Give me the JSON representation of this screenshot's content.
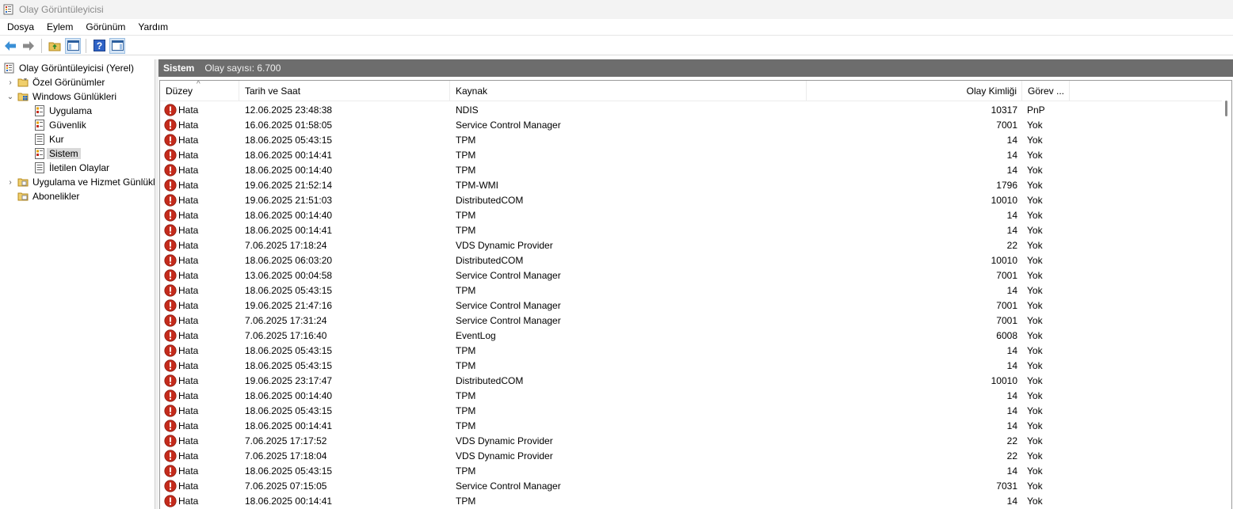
{
  "window": {
    "title": "Olay Görüntüleyicisi"
  },
  "menu": [
    "Dosya",
    "Eylem",
    "Görünüm",
    "Yardım"
  ],
  "toolbar": {
    "buttons": [
      "back-arrow-icon",
      "forward-arrow-icon",
      "folder-up-icon",
      "show-hide-tree-icon",
      "help-icon",
      "show-hide-action-pane-icon"
    ]
  },
  "tree": {
    "root": "Olay Görüntüleyicisi (Yerel)",
    "custom_views": "Özel Görünümler",
    "windows_logs": "Windows Günlükleri",
    "app": "Uygulama",
    "security": "Güvenlik",
    "setup": "Kur",
    "system": "Sistem",
    "forwarded": "İletilen Olaylar",
    "app_services": "Uygulama ve Hizmet Günlükleri",
    "subscriptions": "Abonelikler"
  },
  "pane": {
    "title": "Sistem",
    "count": "Olay sayısı: 6.700"
  },
  "columns": {
    "level": "Düzey",
    "date": "Tarih ve Saat",
    "source": "Kaynak",
    "id": "Olay Kimliği",
    "task": "Görev ..."
  },
  "rows": [
    {
      "level": "Hata",
      "date": "12.06.2025 23:48:38",
      "source": "NDIS",
      "id": "10317",
      "task": "PnP"
    },
    {
      "level": "Hata",
      "date": "16.06.2025 01:58:05",
      "source": "Service Control Manager",
      "id": "7001",
      "task": "Yok"
    },
    {
      "level": "Hata",
      "date": "18.06.2025 05:43:15",
      "source": "TPM",
      "id": "14",
      "task": "Yok"
    },
    {
      "level": "Hata",
      "date": "18.06.2025 00:14:41",
      "source": "TPM",
      "id": "14",
      "task": "Yok"
    },
    {
      "level": "Hata",
      "date": "18.06.2025 00:14:40",
      "source": "TPM",
      "id": "14",
      "task": "Yok"
    },
    {
      "level": "Hata",
      "date": "19.06.2025 21:52:14",
      "source": "TPM-WMI",
      "id": "1796",
      "task": "Yok"
    },
    {
      "level": "Hata",
      "date": "19.06.2025 21:51:03",
      "source": "DistributedCOM",
      "id": "10010",
      "task": "Yok"
    },
    {
      "level": "Hata",
      "date": "18.06.2025 00:14:40",
      "source": "TPM",
      "id": "14",
      "task": "Yok"
    },
    {
      "level": "Hata",
      "date": "18.06.2025 00:14:41",
      "source": "TPM",
      "id": "14",
      "task": "Yok"
    },
    {
      "level": "Hata",
      "date": "7.06.2025 17:18:24",
      "source": "VDS Dynamic Provider",
      "id": "22",
      "task": "Yok"
    },
    {
      "level": "Hata",
      "date": "18.06.2025 06:03:20",
      "source": "DistributedCOM",
      "id": "10010",
      "task": "Yok"
    },
    {
      "level": "Hata",
      "date": "13.06.2025 00:04:58",
      "source": "Service Control Manager",
      "id": "7001",
      "task": "Yok"
    },
    {
      "level": "Hata",
      "date": "18.06.2025 05:43:15",
      "source": "TPM",
      "id": "14",
      "task": "Yok"
    },
    {
      "level": "Hata",
      "date": "19.06.2025 21:47:16",
      "source": "Service Control Manager",
      "id": "7001",
      "task": "Yok"
    },
    {
      "level": "Hata",
      "date": "7.06.2025 17:31:24",
      "source": "Service Control Manager",
      "id": "7001",
      "task": "Yok"
    },
    {
      "level": "Hata",
      "date": "7.06.2025 17:16:40",
      "source": "EventLog",
      "id": "6008",
      "task": "Yok"
    },
    {
      "level": "Hata",
      "date": "18.06.2025 05:43:15",
      "source": "TPM",
      "id": "14",
      "task": "Yok"
    },
    {
      "level": "Hata",
      "date": "18.06.2025 05:43:15",
      "source": "TPM",
      "id": "14",
      "task": "Yok"
    },
    {
      "level": "Hata",
      "date": "19.06.2025 23:17:47",
      "source": "DistributedCOM",
      "id": "10010",
      "task": "Yok"
    },
    {
      "level": "Hata",
      "date": "18.06.2025 00:14:40",
      "source": "TPM",
      "id": "14",
      "task": "Yok"
    },
    {
      "level": "Hata",
      "date": "18.06.2025 05:43:15",
      "source": "TPM",
      "id": "14",
      "task": "Yok"
    },
    {
      "level": "Hata",
      "date": "18.06.2025 00:14:41",
      "source": "TPM",
      "id": "14",
      "task": "Yok"
    },
    {
      "level": "Hata",
      "date": "7.06.2025 17:17:52",
      "source": "VDS Dynamic Provider",
      "id": "22",
      "task": "Yok"
    },
    {
      "level": "Hata",
      "date": "7.06.2025 17:18:04",
      "source": "VDS Dynamic Provider",
      "id": "22",
      "task": "Yok"
    },
    {
      "level": "Hata",
      "date": "18.06.2025 05:43:15",
      "source": "TPM",
      "id": "14",
      "task": "Yok"
    },
    {
      "level": "Hata",
      "date": "7.06.2025 07:15:05",
      "source": "Service Control Manager",
      "id": "7031",
      "task": "Yok"
    },
    {
      "level": "Hata",
      "date": "18.06.2025 00:14:41",
      "source": "TPM",
      "id": "14",
      "task": "Yok"
    }
  ],
  "colors": {
    "header_bg": "#6d6d6d",
    "error_red": "#c42b1c",
    "selection": "#d9d9d9"
  }
}
